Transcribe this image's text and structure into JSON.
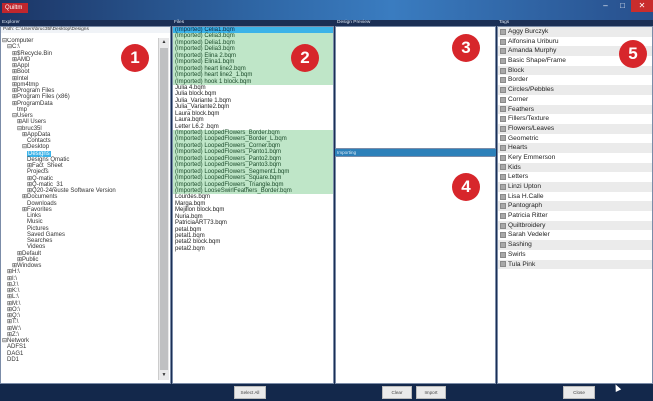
{
  "app": {
    "badge_label": "Quiltm"
  },
  "window_controls": [
    "–",
    "□",
    "✕"
  ],
  "explorer": {
    "header": "Explorer",
    "path": "Path: C:\\Users\\bruc35l\\Desktop\\Designs",
    "tree": [
      {
        "label": "⊟Computer",
        "indent": 0
      },
      {
        "label": "⊟C:\\",
        "indent": 1
      },
      {
        "label": "⊞$Recycle.Bin",
        "indent": 2
      },
      {
        "label": "⊞AMD",
        "indent": 2
      },
      {
        "label": "⊞Appl",
        "indent": 2
      },
      {
        "label": "⊞Boot",
        "indent": 2
      },
      {
        "label": "⊞Intel",
        "indent": 2
      },
      {
        "label": "⊞pm4tmp",
        "indent": 2
      },
      {
        "label": "⊞Program Files",
        "indent": 2
      },
      {
        "label": "⊞Program Files (x86)",
        "indent": 2
      },
      {
        "label": "⊞ProgramData",
        "indent": 2
      },
      {
        "label": "tmp",
        "indent": 3
      },
      {
        "label": "⊟Users",
        "indent": 2
      },
      {
        "label": "⊞All Users",
        "indent": 3
      },
      {
        "label": "⊟bruc35l",
        "indent": 3
      },
      {
        "label": "⊞AppData",
        "indent": 4
      },
      {
        "label": "Contacts",
        "indent": 5
      },
      {
        "label": "⊟Desktop",
        "indent": 4
      },
      {
        "label": "Designs",
        "indent": 5,
        "selected": true
      },
      {
        "label": "Designs Qmatic",
        "indent": 5
      },
      {
        "label": "⊞Fact_Sheet",
        "indent": 5
      },
      {
        "label": "Projects",
        "indent": 5
      },
      {
        "label": "⊞Q-matic",
        "indent": 5
      },
      {
        "label": "⊞Q-matic_31",
        "indent": 5
      },
      {
        "label": "⊞Q20-24reuste Software Version",
        "indent": 5
      },
      {
        "label": "⊞Documents",
        "indent": 4
      },
      {
        "label": "Downloads",
        "indent": 5
      },
      {
        "label": "⊞Favorites",
        "indent": 4
      },
      {
        "label": "Links",
        "indent": 5
      },
      {
        "label": "Music",
        "indent": 5
      },
      {
        "label": "Pictures",
        "indent": 5
      },
      {
        "label": "Saved Games",
        "indent": 5
      },
      {
        "label": "Searches",
        "indent": 5
      },
      {
        "label": "Videos",
        "indent": 5
      },
      {
        "label": "⊞Default",
        "indent": 3
      },
      {
        "label": "⊞Public",
        "indent": 3
      },
      {
        "label": "⊞Windows",
        "indent": 2
      },
      {
        "label": "⊞H:\\",
        "indent": 1
      },
      {
        "label": "⊞I:\\",
        "indent": 1
      },
      {
        "label": "⊞J:\\",
        "indent": 1
      },
      {
        "label": "⊞K:\\",
        "indent": 1
      },
      {
        "label": "⊞L:\\",
        "indent": 1
      },
      {
        "label": "⊞M:\\",
        "indent": 1
      },
      {
        "label": "⊞O:\\",
        "indent": 1
      },
      {
        "label": "⊞Q:\\",
        "indent": 1
      },
      {
        "label": "⊞T:\\",
        "indent": 1
      },
      {
        "label": "⊞W:\\",
        "indent": 1
      },
      {
        "label": "⊞Z:\\",
        "indent": 1
      },
      {
        "label": "⊟Network",
        "indent": 0
      },
      {
        "label": "ADFS1",
        "indent": 1
      },
      {
        "label": "DAG1",
        "indent": 1
      },
      {
        "label": "DD1",
        "indent": 1
      }
    ],
    "scroll_up": "▲",
    "scroll_down": "▼"
  },
  "files": {
    "header": "Files",
    "items": [
      {
        "name": "(Imported) Celia1.bqm",
        "state": "sel"
      },
      {
        "name": "(Imported) Celia3.bqm",
        "state": "green"
      },
      {
        "name": "(Imported) Delia1.bqm",
        "state": "green"
      },
      {
        "name": "(Imported) Delia3.bqm",
        "state": "green"
      },
      {
        "name": "(Imported) Elina 2.bqm",
        "state": "green"
      },
      {
        "name": "(Imported) Elina1.bqm",
        "state": "green"
      },
      {
        "name": "(Imported) heart line2.bqm",
        "state": "green"
      },
      {
        "name": "(Imported) heart line2_1.bqm",
        "state": "green"
      },
      {
        "name": "(Imported) hook 1 block.bqm",
        "state": "green"
      },
      {
        "name": "Julia 4.bqm",
        "state": ""
      },
      {
        "name": "Julia block.bqm",
        "state": ""
      },
      {
        "name": "Julia_Variante 1.bqm",
        "state": ""
      },
      {
        "name": "Julia_Variante2.bqm",
        "state": ""
      },
      {
        "name": "Laura block.bqm",
        "state": ""
      },
      {
        "name": "Laura.bqm",
        "state": ""
      },
      {
        "name": "Letter L6.2 .bqm",
        "state": ""
      },
      {
        "name": "(Imported) LoopedFlowers_Border.bqm",
        "state": "green"
      },
      {
        "name": "(Imported) LoopedFlowers_Border_L.bqm",
        "state": "green"
      },
      {
        "name": "(Imported) LoopedFlowers_Corner.bqm",
        "state": "green"
      },
      {
        "name": "(Imported) LoopedFlowers_Panto1.bqm",
        "state": "green"
      },
      {
        "name": "(Imported) LoopedFlowers_Panto2.bqm",
        "state": "green"
      },
      {
        "name": "(Imported) LoopedFlowers_Panto3.bqm",
        "state": "green"
      },
      {
        "name": "(Imported) LoopedFlowers_Segment1.bqm",
        "state": "green"
      },
      {
        "name": "(Imported) LoopedFlowers_Square.bqm",
        "state": "green"
      },
      {
        "name": "(Imported) LoopedFlowers_Triangle.bqm",
        "state": "green"
      },
      {
        "name": "(Imported) LooseSwirlFeathers_Border.bqm",
        "state": "green"
      },
      {
        "name": "Lourdes.bqm",
        "state": ""
      },
      {
        "name": "Marga.bqm",
        "state": ""
      },
      {
        "name": "Mejillon block.bqm",
        "state": ""
      },
      {
        "name": "Nuria.bqm",
        "state": ""
      },
      {
        "name": "PatriciaART73.bqm",
        "state": ""
      },
      {
        "name": "petal.bqm",
        "state": ""
      },
      {
        "name": "petal1.bqm",
        "state": ""
      },
      {
        "name": "petal2 block.bqm",
        "state": ""
      },
      {
        "name": "petal2.bqm",
        "state": ""
      }
    ]
  },
  "preview": {
    "header": "Design Preview"
  },
  "importing": {
    "header": "Importing"
  },
  "tags": {
    "header": "Tags",
    "items": [
      "Aggy Burczyk",
      "Alfonsina Uriburu",
      "Amanda Murphy",
      "Basic Shape/Frame",
      "Block",
      "Border",
      "Circles/Pebbles",
      "Corner",
      "Feathers",
      "Fillers/Texture",
      "Flowers/Leaves",
      "Geometric",
      "Hearts",
      "Kery Emmerson",
      "Kids",
      "Letters",
      "Linzi Upton",
      "Lisa H.Calle",
      "Pantograph",
      "Patricia Ritter",
      "Quiltbroidery",
      "Sarah Vedeler",
      "Sashing",
      "Swirls",
      "Tula Pink"
    ]
  },
  "badges": [
    "1",
    "2",
    "3",
    "4",
    "5"
  ],
  "buttons": {
    "select_all": "Select All",
    "clear": "Clear",
    "import": "Import",
    "close": "Close"
  }
}
